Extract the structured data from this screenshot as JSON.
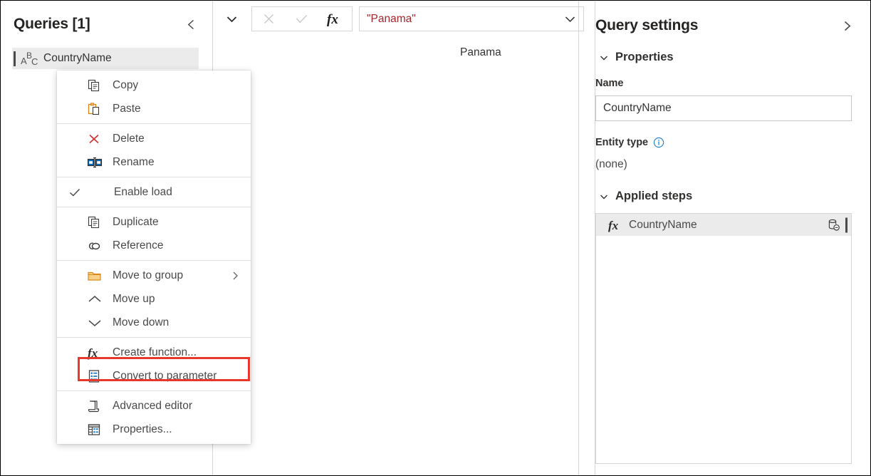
{
  "queries_pane": {
    "title": "Queries [1]",
    "collapse_icon": "chevron-left-icon",
    "items": [
      {
        "label": "CountryName",
        "type_icon": "abc-text-type-icon",
        "selected": true
      }
    ]
  },
  "context_menu": {
    "groups": [
      {
        "items": [
          {
            "label": "Copy",
            "icon": "copy-icon"
          },
          {
            "label": "Paste",
            "icon": "paste-icon"
          }
        ]
      },
      {
        "items": [
          {
            "label": "Delete",
            "icon": "delete-x-icon"
          },
          {
            "label": "Rename",
            "icon": "rename-icon"
          }
        ]
      },
      {
        "items": [
          {
            "label": "Enable load",
            "icon": "checkmark-icon",
            "checked": true
          }
        ]
      },
      {
        "items": [
          {
            "label": "Duplicate",
            "icon": "duplicate-icon"
          },
          {
            "label": "Reference",
            "icon": "reference-link-icon"
          }
        ]
      },
      {
        "items": [
          {
            "label": "Move to group",
            "icon": "folder-icon",
            "submenu_icon": "chevron-right-icon"
          },
          {
            "label": "Move up",
            "icon": "chevron-up-icon"
          },
          {
            "label": "Move down",
            "icon": "chevron-down-icon"
          }
        ]
      },
      {
        "items": [
          {
            "label": "Create function...",
            "icon": "fx-icon"
          },
          {
            "label": "Convert to parameter",
            "icon": "parameter-list-icon",
            "highlighted": true
          }
        ]
      },
      {
        "items": [
          {
            "label": "Advanced editor",
            "icon": "advanced-editor-scroll-icon"
          },
          {
            "label": "Properties...",
            "icon": "properties-table-icon"
          }
        ]
      }
    ],
    "highlight_color": "#e8382c"
  },
  "preview_pane": {
    "expand_icon": "chevron-down-icon",
    "cancel_icon": "cancel-x-icon",
    "accept_icon": "accept-check-icon",
    "fx_icon": "fx-icon",
    "formula_value": "\"Panama\"",
    "formula_text_color": "#a4262c",
    "dropdown_icon": "chevron-down-icon",
    "preview_value": "Panama"
  },
  "query_settings": {
    "title": "Query settings",
    "expand_icon": "chevron-right-icon",
    "properties_section": {
      "label": "Properties",
      "chevron_icon": "chevron-down-icon",
      "name_label": "Name",
      "name_value": "CountryName",
      "entity_type_label": "Entity type",
      "entity_type_info_icon": "info-circle-icon",
      "entity_type_value": "(none)"
    },
    "applied_steps_section": {
      "label": "Applied steps",
      "chevron_icon": "chevron-down-icon",
      "steps": [
        {
          "label": "CountryName",
          "icon": "fx-icon",
          "action_icon": "data-source-settings-icon"
        }
      ]
    }
  }
}
